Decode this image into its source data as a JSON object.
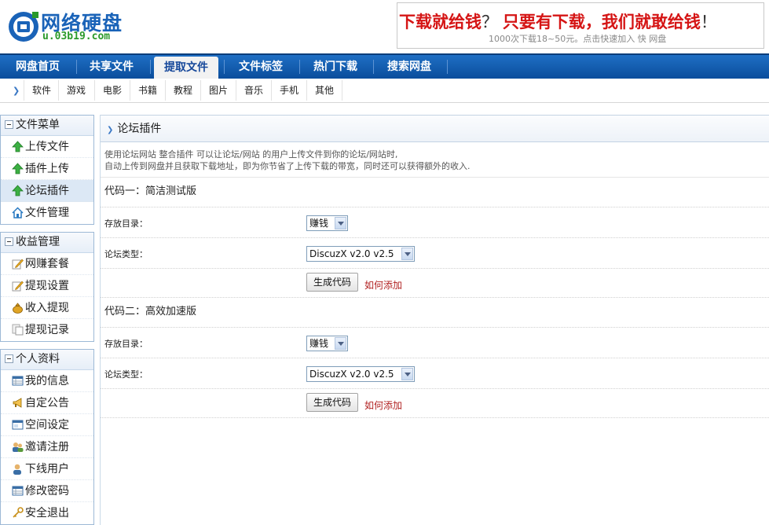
{
  "header": {
    "logo_text": "网络硬盘",
    "logo_url": "u.03b19.com",
    "ad_main_1": "下载就给钱",
    "ad_q": "？",
    "ad_main_2": " 只要有下载，我们就敢给钱",
    "ad_excl": "！",
    "ad_sub": "1000次下载18~50元。点击快速加入 快 网盘"
  },
  "mainnav": {
    "items": [
      "网盘首页",
      "共享文件",
      "提取文件",
      "文件标签",
      "热门下载",
      "搜索网盘"
    ],
    "active_index": 2
  },
  "subnav": {
    "items": [
      "软件",
      "游戏",
      "电影",
      "书籍",
      "教程",
      "图片",
      "音乐",
      "手机",
      "其他"
    ]
  },
  "sidebar": {
    "groups": [
      {
        "title": "文件菜单",
        "items": [
          {
            "label": "上传文件",
            "icon": "green-up-arrow-icon"
          },
          {
            "label": "插件上传",
            "icon": "green-up-arrow-icon"
          },
          {
            "label": "论坛插件",
            "icon": "green-up-arrow-icon",
            "active": true
          },
          {
            "label": "文件管理",
            "icon": "home-icon"
          }
        ]
      },
      {
        "title": "收益管理",
        "items": [
          {
            "label": "网赚套餐",
            "icon": "pencil-icon"
          },
          {
            "label": "提现设置",
            "icon": "pencil-icon"
          },
          {
            "label": "收入提现",
            "icon": "money-bag-icon"
          },
          {
            "label": "提现记录",
            "icon": "documents-icon"
          }
        ]
      },
      {
        "title": "个人资料",
        "items": [
          {
            "label": "我的信息",
            "icon": "table-icon"
          },
          {
            "label": "自定公告",
            "icon": "megaphone-icon"
          },
          {
            "label": "空间设定",
            "icon": "window-icon"
          },
          {
            "label": "邀请注册",
            "icon": "users-icon"
          },
          {
            "label": "下线用户",
            "icon": "user-icon"
          },
          {
            "label": "修改密码",
            "icon": "table-icon"
          },
          {
            "label": "安全退出",
            "icon": "key-icon"
          }
        ]
      }
    ]
  },
  "content": {
    "title": "论坛插件",
    "desc_line1": "使用论坛网站 整合插件 可以让论坛/网站 的用户上传文件到你的论坛/网站时,",
    "desc_line2": "自动上传到网盘并且获取下载地址，即为你节省了上传下载的带宽，同时还可以获得额外的收入.",
    "sections": [
      {
        "title": "代码一：简洁测试版",
        "dir_label": "存放目录：",
        "dir_value": "赚钱",
        "type_label": "论坛类型：",
        "type_value": "DiscuzX v2.0 v2.5",
        "button": "生成代码",
        "howto": "如何添加"
      },
      {
        "title": "代码二：高效加速版",
        "dir_label": "存放目录：",
        "dir_value": "赚钱",
        "type_label": "论坛类型：",
        "type_value": "DiscuzX v2.0 v2.5",
        "button": "生成代码",
        "howto": "如何添加"
      }
    ]
  },
  "colors": {
    "nav_blue": "#0a4d9c",
    "ad_red": "#d51515",
    "logo_blue": "#1a63b8",
    "link_red": "#b12121"
  }
}
